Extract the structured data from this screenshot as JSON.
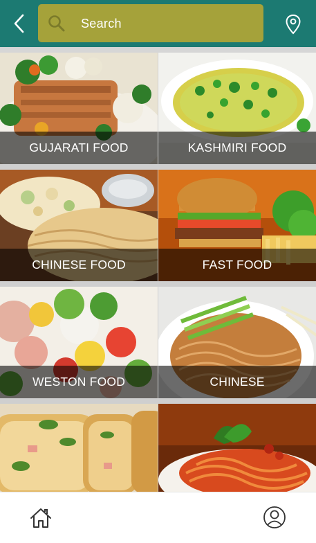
{
  "header": {
    "search_label": "Search",
    "back_icon": "chevron-left-icon",
    "location_icon": "map-pin-icon",
    "background_color": "#1c7a72",
    "search_color": "#a5a23a"
  },
  "categories": [
    {
      "label": "GUJARATI FOOD"
    },
    {
      "label": "KASHMIRI FOOD"
    },
    {
      "label": "CHINESE FOOD"
    },
    {
      "label": "FAST FOOD"
    },
    {
      "label": "WESTON FOOD"
    },
    {
      "label": "CHINESE"
    },
    {
      "label": ""
    },
    {
      "label": ""
    }
  ],
  "bottom_nav": {
    "home_icon": "home-icon",
    "profile_icon": "user-icon"
  }
}
